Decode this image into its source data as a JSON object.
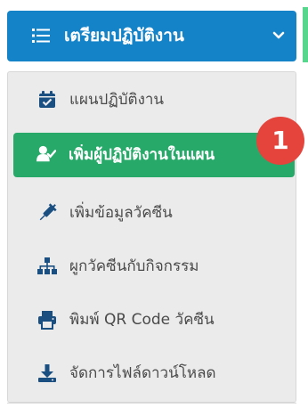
{
  "header": {
    "title": "เตรียมปฏิบัติงาน",
    "menu_icon": "list-icon",
    "chevron_icon": "chevron-down-icon"
  },
  "menu": {
    "items": [
      {
        "label": "แผนปฏิบัติงาน",
        "icon": "calendar-check-icon",
        "active": false
      },
      {
        "label": "เพิ่มผู้ปฏิบัติงานในแผน",
        "icon": "user-check-icon",
        "active": true
      },
      {
        "label": "เพิ่มข้อมูลวัคซีน",
        "icon": "syringe-icon",
        "active": false
      },
      {
        "label": "ผูกวัคซีนกับกิจกรรม",
        "icon": "sitemap-icon",
        "active": false
      },
      {
        "label": "พิมพ์ QR Code วัคซีน",
        "icon": "printer-icon",
        "active": false
      },
      {
        "label": "จัดการไฟล์ดาวน์โหลด",
        "icon": "download-icon",
        "active": false
      }
    ]
  },
  "badge": {
    "value": "1"
  },
  "colors": {
    "header": "#1583c8",
    "active": "#27a96a",
    "badge": "#e4443b",
    "icon": "#1a4f82"
  }
}
